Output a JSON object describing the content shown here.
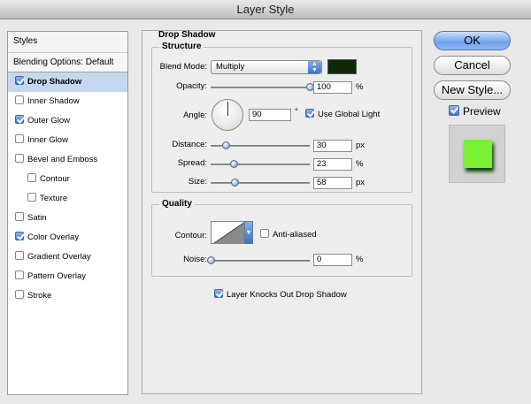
{
  "window": {
    "title": "Layer Style"
  },
  "styles_panel": {
    "header": "Styles",
    "blending": "Blending Options: Default",
    "items": [
      {
        "label": "Drop Shadow",
        "checked": true,
        "selected": true,
        "sub": false
      },
      {
        "label": "Inner Shadow",
        "checked": false,
        "selected": false,
        "sub": false
      },
      {
        "label": "Outer Glow",
        "checked": true,
        "selected": false,
        "sub": false
      },
      {
        "label": "Inner Glow",
        "checked": false,
        "selected": false,
        "sub": false
      },
      {
        "label": "Bevel and Emboss",
        "checked": false,
        "selected": false,
        "sub": false
      },
      {
        "label": "Contour",
        "checked": false,
        "selected": false,
        "sub": true
      },
      {
        "label": "Texture",
        "checked": false,
        "selected": false,
        "sub": true
      },
      {
        "label": "Satin",
        "checked": false,
        "selected": false,
        "sub": false
      },
      {
        "label": "Color Overlay",
        "checked": true,
        "selected": false,
        "sub": false
      },
      {
        "label": "Gradient Overlay",
        "checked": false,
        "selected": false,
        "sub": false
      },
      {
        "label": "Pattern Overlay",
        "checked": false,
        "selected": false,
        "sub": false
      },
      {
        "label": "Stroke",
        "checked": false,
        "selected": false,
        "sub": false
      }
    ]
  },
  "drop_shadow": {
    "title": "Drop Shadow",
    "structure": {
      "legend": "Structure",
      "blend_mode_label": "Blend Mode:",
      "blend_mode_value": "Multiply",
      "shadow_color": "#0e2a0a",
      "opacity_label": "Opacity:",
      "opacity_value": "100",
      "opacity_unit": "%",
      "opacity_level": 1.0,
      "angle_label": "Angle:",
      "angle_value": "90",
      "angle_unit": "°",
      "use_global_light_label": "Use Global Light",
      "use_global_light": true,
      "distance_label": "Distance:",
      "distance_value": "30",
      "distance_unit": "px",
      "distance_level": 0.15,
      "spread_label": "Spread:",
      "spread_value": "23",
      "spread_unit": "%",
      "spread_level": 0.23,
      "size_label": "Size:",
      "size_value": "58",
      "size_unit": "px",
      "size_level": 0.24
    },
    "quality": {
      "legend": "Quality",
      "contour_label": "Contour:",
      "anti_aliased_label": "Anti-aliased",
      "anti_aliased": false,
      "noise_label": "Noise:",
      "noise_value": "0",
      "noise_unit": "%",
      "noise_level": 0.0
    },
    "knockout_label": "Layer Knocks Out Drop Shadow",
    "knockout": true
  },
  "buttons": {
    "ok": "OK",
    "cancel": "Cancel",
    "new_style": "New Style...",
    "preview_label": "Preview",
    "preview_checked": true
  },
  "colors": {
    "preview_fill": "#7bf035",
    "accent": "#3d78d0"
  }
}
